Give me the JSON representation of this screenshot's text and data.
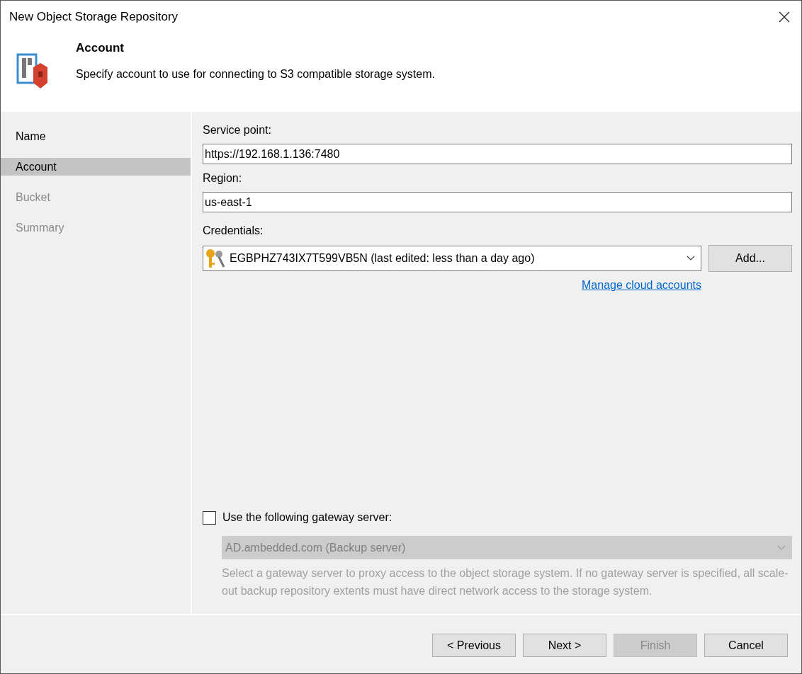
{
  "window": {
    "title": "New Object Storage Repository"
  },
  "header": {
    "title": "Account",
    "description": "Specify account to use for connecting to S3 compatible storage system."
  },
  "steps": [
    {
      "label": "Name",
      "selected": false,
      "disabled": false
    },
    {
      "label": "Account",
      "selected": true,
      "disabled": false
    },
    {
      "label": "Bucket",
      "selected": false,
      "disabled": true
    },
    {
      "label": "Summary",
      "selected": false,
      "disabled": true
    }
  ],
  "form": {
    "service_point": {
      "label": "Service point:",
      "value": "https://192.168.1.136:7480"
    },
    "region": {
      "label": "Region:",
      "value": "us-east-1"
    },
    "credentials": {
      "label": "Credentials:",
      "value": "EGBPHZ743IX7T599VB5N (last edited: less than a day ago)",
      "add_button": "Add...",
      "manage_link": "Manage cloud accounts"
    },
    "gateway": {
      "label": "Use the following gateway server:",
      "checked": false,
      "value": "AD.ambedded.com (Backup server)",
      "hint": "Select a gateway server to proxy access to the object storage system. If no gateway server is specified, all scale-out backup repository extents must have direct network access to the storage system."
    }
  },
  "buttons": [
    {
      "label": "< Previous",
      "disabled": false
    },
    {
      "label": "Next >",
      "disabled": false
    },
    {
      "label": "Finish",
      "disabled": true
    },
    {
      "label": "Cancel",
      "disabled": false
    }
  ]
}
